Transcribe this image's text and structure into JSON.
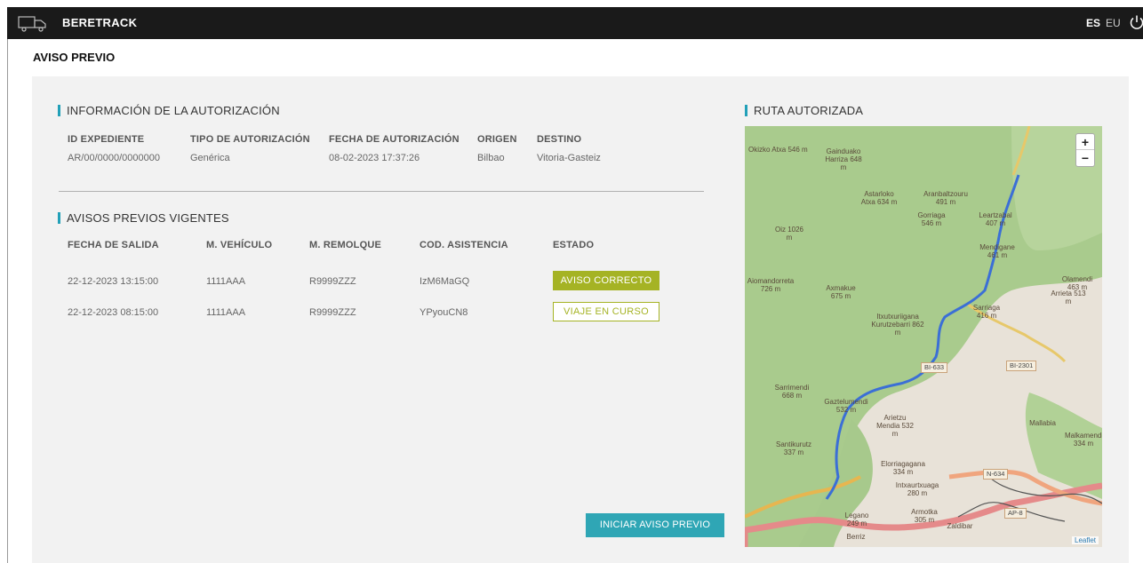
{
  "header": {
    "brand": "BERETRACK",
    "lang_es": "ES",
    "lang_eu": "EU"
  },
  "page": {
    "title": "AVISO PREVIO"
  },
  "auth": {
    "section_title": "INFORMACIÓN DE LA AUTORIZACIÓN",
    "labels": {
      "id": "ID EXPEDIENTE",
      "tipo": "TIPO DE AUTORIZACIÓN",
      "fecha": "FECHA DE AUTORIZACIÓN",
      "origen": "ORIGEN",
      "destino": "DESTINO"
    },
    "values": {
      "id": "AR/00/0000/0000000",
      "tipo": "Genérica",
      "fecha": "08-02-2023 17:37:26",
      "origen": "Bilbao",
      "destino": "Vitoria-Gasteiz"
    }
  },
  "avisos": {
    "section_title": "AVISOS PREVIOS VIGENTES",
    "columns": [
      "FECHA DE SALIDA",
      "M. VEHÍCULO",
      "M. REMOLQUE",
      "COD. ASISTENCIA",
      "ESTADO"
    ],
    "rows": [
      {
        "fecha": "22-12-2023 13:15:00",
        "vehiculo": "1111AAA",
        "remolque": "R9999ZZZ",
        "codigo": "IzM6MaGQ",
        "estado": "AVISO CORRECTO"
      },
      {
        "fecha": "22-12-2023 08:15:00",
        "vehiculo": "1111AAA",
        "remolque": "R9999ZZZ",
        "codigo": "YPyouCN8",
        "estado": "VIAJE EN CURSO"
      }
    ],
    "start_button": "INICIAR AVISO PREVIO"
  },
  "route": {
    "section_title": "RUTA AUTORIZADA",
    "zoom_in": "+",
    "zoom_out": "−",
    "attribution": "Leaflet",
    "places": [
      "Okizko Atxa 546 m",
      "Gainduako Harriza 648 m",
      "Astarloko Atxa 634 m",
      "Aranbaltzouru 491 m",
      "Gorriaga 546 m",
      "Leartzabal 407 m",
      "Oiz 1026 m",
      "Mendigane 461 m",
      "Olamendi 463 m",
      "Aiomandorreta 726 m",
      "Axmakue 675 m",
      "Arrieta 513 m",
      "Sarriaga 416 m",
      "Itxutxuriigana Kurutzebarri 862 m",
      "Sarrimendi 668 m",
      "Gaztelumendi 532 m",
      "Arietzu Mendia 532 m",
      "Mallabia",
      "Malkamendi 334 m",
      "Santikurutz 337 m",
      "Elorriagagana 334 m",
      "Intxaurtxuaga 280 m",
      "Legano 249 m",
      "Armotka 305 m",
      "Berriz",
      "Zaldibar"
    ],
    "roads": [
      "BI-633",
      "BI-2301",
      "N-634",
      "AP-8"
    ]
  }
}
